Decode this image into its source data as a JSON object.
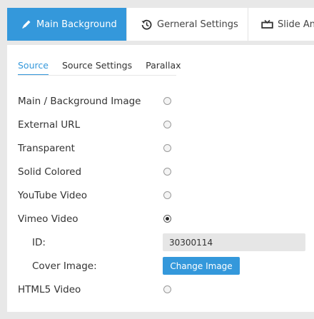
{
  "top_tabs": [
    {
      "label": "Main Background",
      "icon": "pencil-icon",
      "active": true
    },
    {
      "label": "Gerneral Settings",
      "icon": "history-icon",
      "active": false
    },
    {
      "label": "Slide An",
      "icon": "slide-animation-icon",
      "active": false
    }
  ],
  "sub_tabs": [
    {
      "label": "Source",
      "active": true
    },
    {
      "label": "Source Settings",
      "active": false
    },
    {
      "label": "Parallax",
      "active": false
    }
  ],
  "source_options": [
    {
      "label": "Main / Background Image",
      "checked": false
    },
    {
      "label": "External URL",
      "checked": false
    },
    {
      "label": "Transparent",
      "checked": false
    },
    {
      "label": "Solid Colored",
      "checked": false
    },
    {
      "label": "YouTube Video",
      "checked": false
    },
    {
      "label": "Vimeo Video",
      "checked": true
    }
  ],
  "vimeo": {
    "id_label": "ID:",
    "id_value": "30300114",
    "cover_label": "Cover Image:",
    "change_button": "Change Image"
  },
  "html5_option": {
    "label": "HTML5 Video",
    "checked": false
  },
  "colors": {
    "accent": "#3498db",
    "background": "#e8e8e8",
    "panel": "#ffffff"
  }
}
